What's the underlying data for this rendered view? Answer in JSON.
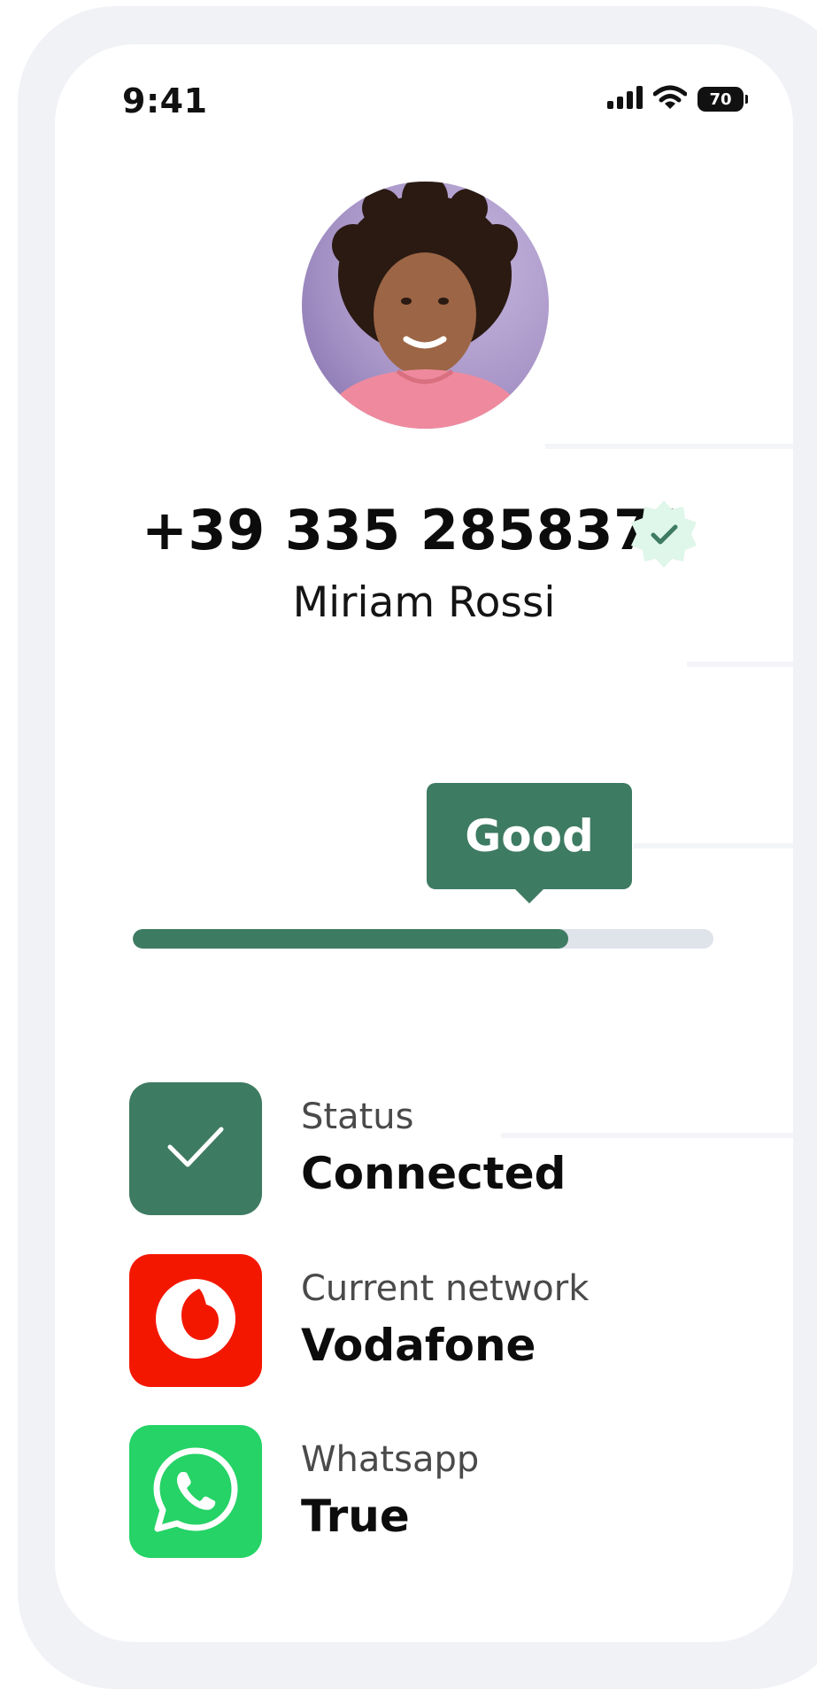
{
  "status_bar": {
    "time": "9:41",
    "battery": "70"
  },
  "contact": {
    "phone": "+39 335 2858371",
    "name": "Miriam Rossi",
    "verified": true
  },
  "quality": {
    "label": "Good",
    "progress_fraction": 0.75
  },
  "details": [
    {
      "label": "Status",
      "value": "Connected",
      "icon": "check-icon",
      "color": "#3e7b63"
    },
    {
      "label": "Current network",
      "value": "Vodafone",
      "icon": "vodafone-logo-icon",
      "color": "#f41700"
    },
    {
      "label": "Whatsapp",
      "value": "True",
      "icon": "whatsapp-logo-icon",
      "color": "#25d366"
    }
  ],
  "colors": {
    "accent": "#3e7b63",
    "track": "#dfe3ea",
    "verified_badge": "#dff6ea"
  }
}
